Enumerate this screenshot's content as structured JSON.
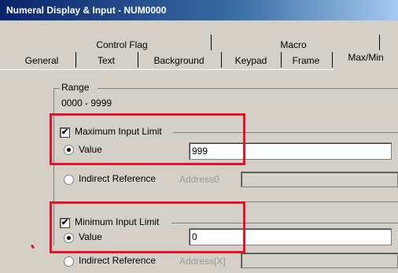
{
  "window": {
    "title": "Numeral Display & Input - NUM0000"
  },
  "tabs_top": [
    "Control Flag",
    "Macro"
  ],
  "tabs_bottom": [
    "General",
    "Text",
    "Background",
    "Keypad",
    "Frame",
    "Max/Min"
  ],
  "active_tab": "Max/Min",
  "range": {
    "label": "Range",
    "value": "0000 - 9999"
  },
  "max_limit": {
    "checkbox_label": "Maximum Input Limit",
    "value_label": "Value",
    "value": "999",
    "indirect_label": "Indirect Reference",
    "address_label": "Address0",
    "address_value": ""
  },
  "min_limit": {
    "checkbox_label": "Minimum Input Limit",
    "value_label": "Value",
    "value": "0",
    "indirect_label": "Indirect Reference",
    "address_label": "Address[X]",
    "address_value": ""
  },
  "colors": {
    "title_start": "#0a246a",
    "title_end": "#a6caf0",
    "dialog": "#d4d0c8",
    "highlight": "#e8102a"
  }
}
